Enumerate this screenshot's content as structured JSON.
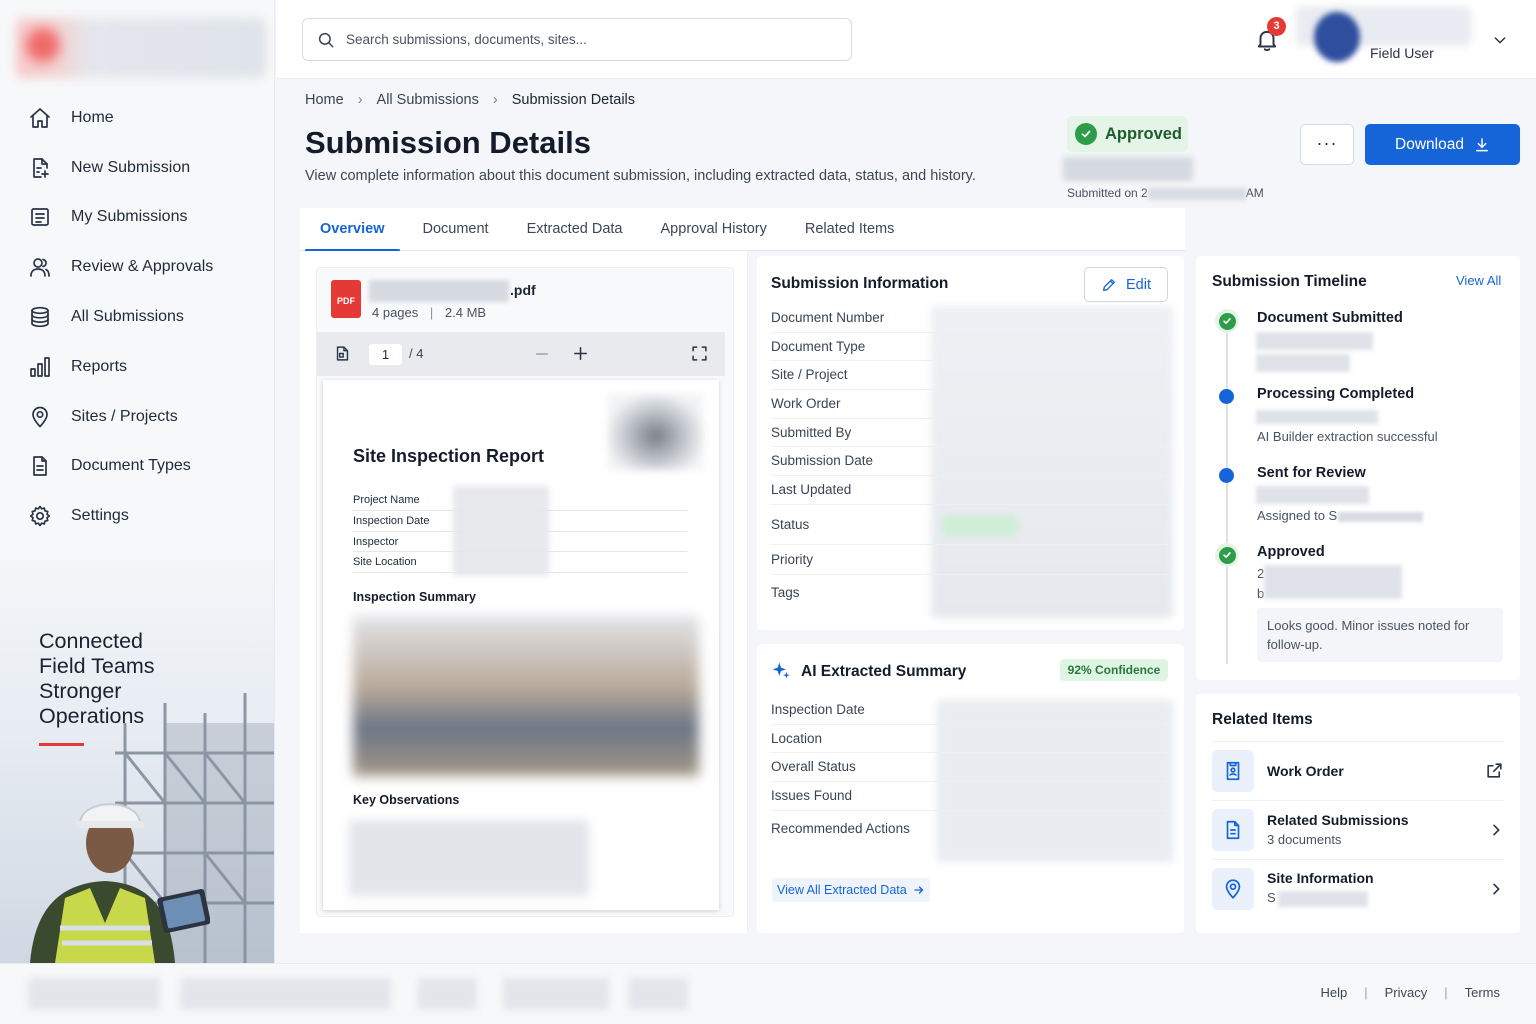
{
  "sidebar": {
    "items": [
      {
        "label": "Home",
        "icon": "home-icon"
      },
      {
        "label": "New Submission",
        "icon": "file-plus-icon"
      },
      {
        "label": "My Submissions",
        "icon": "list-document-icon"
      },
      {
        "label": "Review & Approvals",
        "icon": "users-icon"
      },
      {
        "label": "All Submissions",
        "icon": "database-icon"
      },
      {
        "label": "Reports",
        "icon": "bar-chart-icon"
      },
      {
        "label": "Sites / Projects",
        "icon": "map-pin-icon"
      },
      {
        "label": "Document Types",
        "icon": "document-icon"
      },
      {
        "label": "Settings",
        "icon": "gear-icon"
      }
    ],
    "promo": {
      "line1": "Connected",
      "line2": "Field Teams",
      "line3": "Stronger",
      "line4": "Operations",
      "accent_color": "#e53935"
    }
  },
  "header": {
    "search_placeholder": "Search submissions, documents, sites...",
    "notification_count": "3",
    "user_role": "Field User"
  },
  "breadcrumb": {
    "home": "Home",
    "all_submissions": "All Submissions",
    "current": "Submission Details"
  },
  "page": {
    "title": "Submission Details",
    "subtitle": "View complete information about this document submission, including extracted data, status, and history.",
    "status": "Approved",
    "submitted_on_prefix": "Submitted on 2",
    "submitted_on_suffix": "AM",
    "more_label": "···",
    "download_label": "Download"
  },
  "tabs": [
    {
      "label": "Overview",
      "active": true
    },
    {
      "label": "Document",
      "active": false
    },
    {
      "label": "Extracted Data",
      "active": false
    },
    {
      "label": "Approval History",
      "active": false
    },
    {
      "label": "Related Items",
      "active": false
    }
  ],
  "document": {
    "file_ext": ".pdf",
    "pages_label": "4 pages",
    "size_label": "2.4 MB",
    "pdf_badge": "PDF",
    "current_page": "1",
    "total_pages": "/ 4",
    "report_title": "Site Inspection Report",
    "fields": [
      "Project Name",
      "Inspection Date",
      "Inspector",
      "Site Location"
    ],
    "summary_heading": "Inspection Summary",
    "observations_heading": "Key Observations"
  },
  "submission_info": {
    "title": "Submission Information",
    "edit_label": "Edit",
    "fields": [
      "Document Number",
      "Document Type",
      "Site / Project",
      "Work Order",
      "Submitted By",
      "Submission Date",
      "Last Updated",
      "Status",
      "Priority",
      "Tags"
    ]
  },
  "ai_summary": {
    "title": "AI Extracted Summary",
    "confidence": "92% Confidence",
    "fields": [
      "Inspection Date",
      "Location",
      "Overall Status",
      "Issues Found",
      "Recommended Actions"
    ],
    "view_all_label": "View All Extracted Data"
  },
  "timeline": {
    "title": "Submission Timeline",
    "view_all": "View All",
    "events": [
      {
        "title": "Document Submitted",
        "status": "complete"
      },
      {
        "title": "Processing Completed",
        "sub": "AI Builder extraction successful",
        "status": "current"
      },
      {
        "title": "Sent for Review",
        "sub": "Assigned to S",
        "status": "current"
      },
      {
        "title": "Approved",
        "sub1": "2",
        "sub2": "b",
        "note": "Looks good. Minor issues noted for follow-up.",
        "status": "complete"
      }
    ]
  },
  "related": {
    "title": "Related Items",
    "items": [
      {
        "title": "Work Order",
        "sub": "",
        "icon": "work-order-icon",
        "action": "external-link-icon"
      },
      {
        "title": "Related Submissions",
        "sub": "3 documents",
        "icon": "document-icon",
        "action": "chevron-right-icon"
      },
      {
        "title": "Site Information",
        "sub": "S",
        "icon": "map-pin-icon",
        "action": "chevron-right-icon"
      }
    ]
  },
  "footer": {
    "help": "Help",
    "privacy": "Privacy",
    "terms": "Terms"
  },
  "colors": {
    "primary": "#1565d8",
    "success": "#2e9d4a",
    "danger": "#e53935"
  }
}
